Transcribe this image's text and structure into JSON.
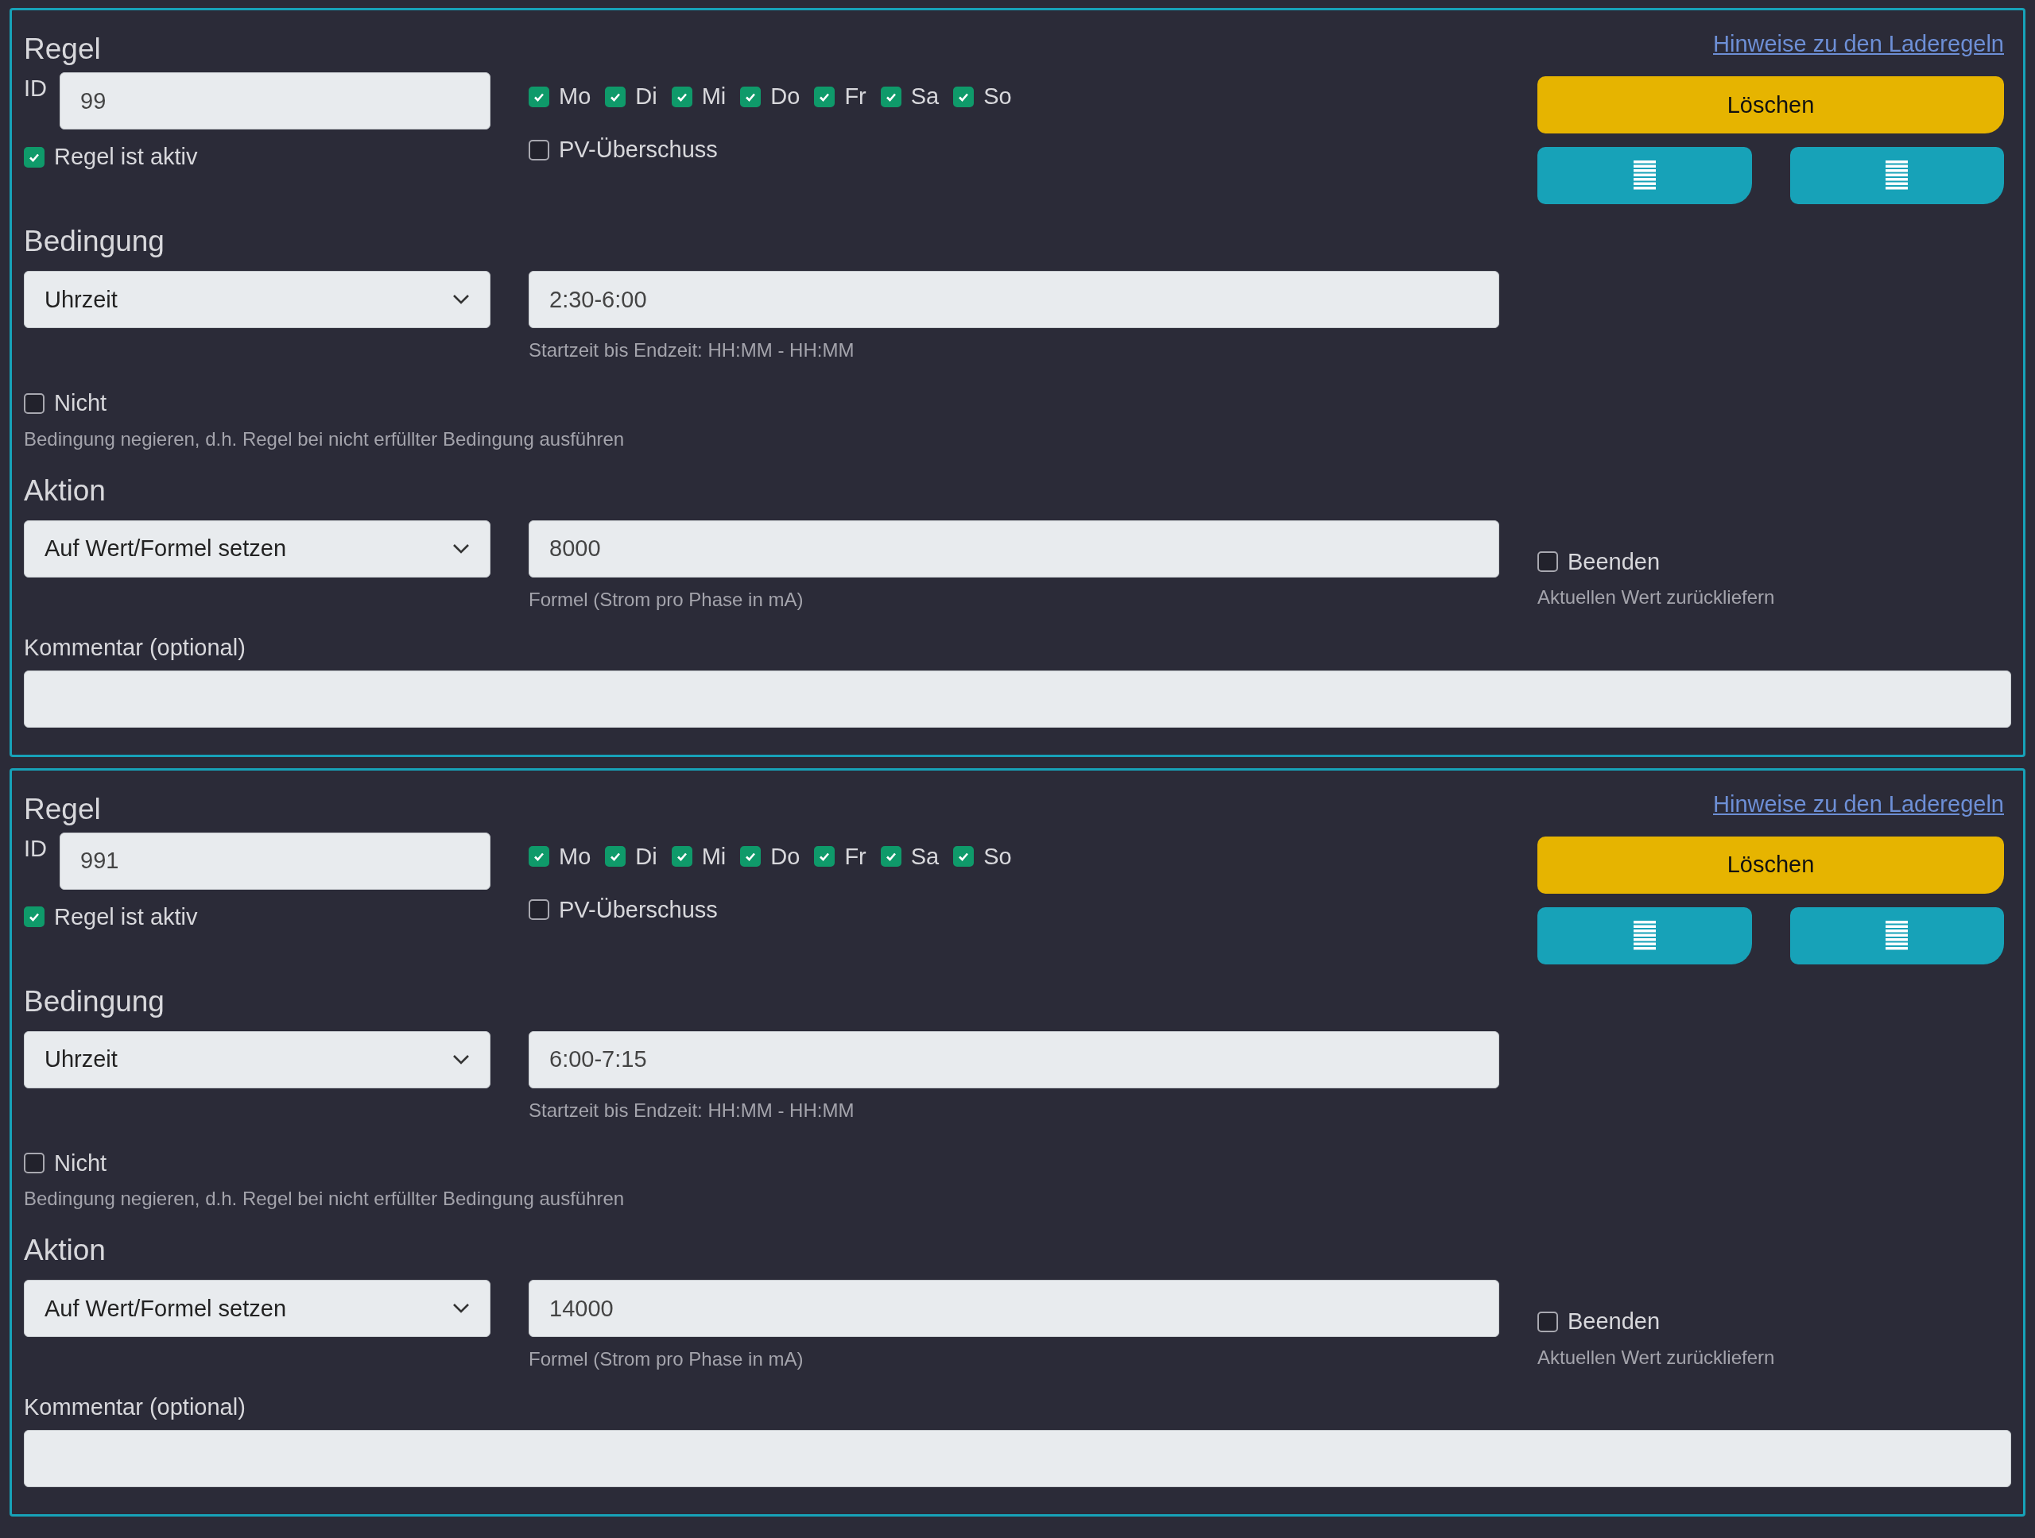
{
  "rules": [
    {
      "title": "Regel",
      "link": "Hinweise zu den Laderegeln",
      "id_label": "ID",
      "id_value": "99",
      "days": [
        {
          "label": "Mo",
          "checked": true
        },
        {
          "label": "Di",
          "checked": true
        },
        {
          "label": "Mi",
          "checked": true
        },
        {
          "label": "Do",
          "checked": true
        },
        {
          "label": "Fr",
          "checked": true
        },
        {
          "label": "Sa",
          "checked": true
        },
        {
          "label": "So",
          "checked": true
        }
      ],
      "active": {
        "label": "Regel ist aktiv",
        "checked": true
      },
      "pv": {
        "label": "PV-Überschuss",
        "checked": false
      },
      "delete_label": "Löschen",
      "condition": {
        "heading": "Bedingung",
        "select": "Uhrzeit",
        "value": "2:30-6:00",
        "hint": "Startzeit bis Endzeit: HH:MM - HH:MM",
        "negate": {
          "label": "Nicht",
          "checked": false
        },
        "negate_hint": "Bedingung negieren, d.h. Regel bei nicht erfüllter Bedingung ausführen"
      },
      "action": {
        "heading": "Aktion",
        "select": "Auf Wert/Formel setzen",
        "value": "8000",
        "hint": "Formel (Strom pro Phase in mA)",
        "finish": {
          "label": "Beenden",
          "checked": false
        },
        "finish_hint": "Aktuellen Wert zurückliefern"
      },
      "comment_label": "Kommentar (optional)"
    },
    {
      "title": "Regel",
      "link": "Hinweise zu den Laderegeln",
      "id_label": "ID",
      "id_value": "991",
      "days": [
        {
          "label": "Mo",
          "checked": true
        },
        {
          "label": "Di",
          "checked": true
        },
        {
          "label": "Mi",
          "checked": true
        },
        {
          "label": "Do",
          "checked": true
        },
        {
          "label": "Fr",
          "checked": true
        },
        {
          "label": "Sa",
          "checked": true
        },
        {
          "label": "So",
          "checked": true
        }
      ],
      "active": {
        "label": "Regel ist aktiv",
        "checked": true
      },
      "pv": {
        "label": "PV-Überschuss",
        "checked": false
      },
      "delete_label": "Löschen",
      "condition": {
        "heading": "Bedingung",
        "select": "Uhrzeit",
        "value": "6:00-7:15",
        "hint": "Startzeit bis Endzeit: HH:MM - HH:MM",
        "negate": {
          "label": "Nicht",
          "checked": false
        },
        "negate_hint": "Bedingung negieren, d.h. Regel bei nicht erfüllter Bedingung ausführen"
      },
      "action": {
        "heading": "Aktion",
        "select": "Auf Wert/Formel setzen",
        "value": "14000",
        "hint": "Formel (Strom pro Phase in mA)",
        "finish": {
          "label": "Beenden",
          "checked": false
        },
        "finish_hint": "Aktuellen Wert zurückliefern"
      },
      "comment_label": "Kommentar (optional)"
    }
  ]
}
